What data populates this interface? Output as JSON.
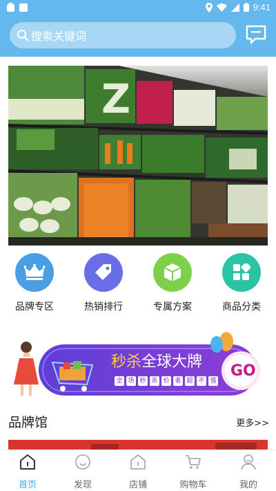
{
  "status_bar": {
    "time": "9:41"
  },
  "search": {
    "placeholder": "搜索关键词"
  },
  "categories": [
    {
      "label": "品牌专区",
      "icon": "crown-icon",
      "color": "#4a9ee4"
    },
    {
      "label": "热销排行",
      "icon": "tag-icon",
      "color": "#6a6ee6"
    },
    {
      "label": "专属方案",
      "icon": "cube-icon",
      "color": "#7ed04a"
    },
    {
      "label": "商品分类",
      "icon": "grid-icon",
      "color": "#2bc3a6"
    }
  ],
  "promo": {
    "title_a": "秒杀",
    "title_b": "全球大牌",
    "chars": [
      "全",
      "场",
      "秒",
      "杀",
      "价",
      "者",
      "超",
      "不",
      "值"
    ],
    "go": "GO"
  },
  "section": {
    "title": "品牌馆",
    "more": "更多>>"
  },
  "tabs": [
    {
      "label": "首页",
      "icon": "home-icon",
      "active": true
    },
    {
      "label": "发现",
      "icon": "discover-icon",
      "active": false
    },
    {
      "label": "店铺",
      "icon": "store-icon",
      "active": false
    },
    {
      "label": "购物车",
      "icon": "cart-icon",
      "active": false
    },
    {
      "label": "我的",
      "icon": "profile-icon",
      "active": false
    }
  ],
  "colors": {
    "header": "#64b8ee",
    "accent": "#49a6e6",
    "promo_bg": "#7b3bd9"
  }
}
